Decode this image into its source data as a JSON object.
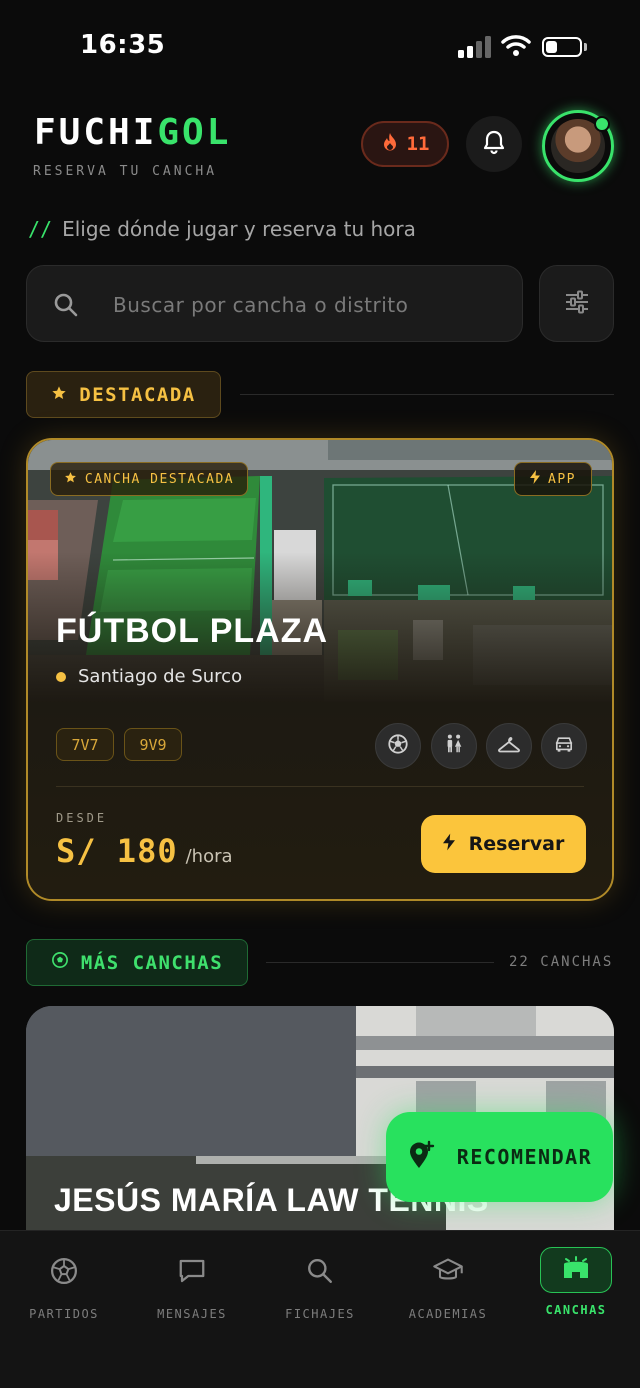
{
  "status_bar": {
    "time": "16:35",
    "battery_level": 0.35
  },
  "header": {
    "logo_part1": "FUCHI",
    "logo_part2": "GOL",
    "tagline": "RESERVA TU CANCHA",
    "streak_count": "11",
    "icons": {
      "streak": "fire-icon",
      "notifications": "bell-icon",
      "avatar": "user-avatar"
    }
  },
  "subtitle": {
    "prefix": "//",
    "text": "Elige dónde jugar y reserva tu hora"
  },
  "search": {
    "placeholder": "Buscar por cancha o distrito"
  },
  "featured_section": {
    "label": "DESTACADA"
  },
  "featured_card": {
    "badge": "CANCHA DESTACADA",
    "app_badge": "APP",
    "name": "FÚTBOL PLAZA",
    "location": "Santiago de Surco",
    "formats": [
      "7V7",
      "9V9"
    ],
    "amenities": [
      "soccer-ball-icon",
      "restroom-icon",
      "hanger-icon",
      "parking-car-icon"
    ],
    "price_label": "DESDE",
    "price": "S/ 180",
    "price_unit": "/hora",
    "reserve_label": "Reservar"
  },
  "more_section": {
    "label": "MÁS CANCHAS",
    "count": "22 CANCHAS"
  },
  "second_card": {
    "name": "JESÚS MARÍA LAW TENNIS"
  },
  "fab": {
    "label": "RECOMENDAR"
  },
  "bottom_nav": {
    "items": [
      {
        "label": "PARTIDOS",
        "icon": "soccer-ball-icon"
      },
      {
        "label": "MENSAJES",
        "icon": "chat-icon"
      },
      {
        "label": "FICHAJES",
        "icon": "search-icon"
      },
      {
        "label": "ACADEMIAS",
        "icon": "graduation-cap-icon"
      },
      {
        "label": "CANCHAS",
        "icon": "stadium-icon",
        "active": true
      }
    ]
  },
  "colors": {
    "accent_green": "#39e36b",
    "accent_gold": "#f6c143",
    "background": "#0b0b0b",
    "streak": "#ff6a3a"
  }
}
